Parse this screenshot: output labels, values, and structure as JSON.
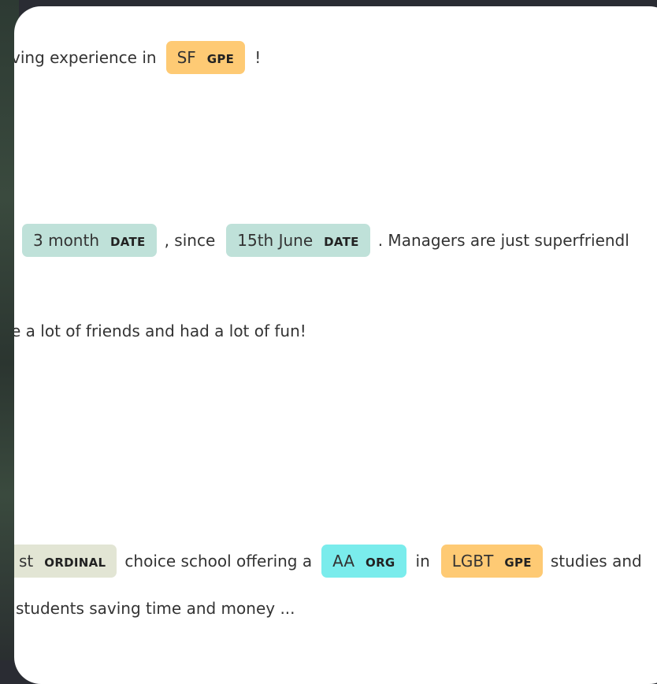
{
  "colors": {
    "GPE": "#feca74",
    "DATE": "#bfe1d9",
    "ORDINAL": "#e2e5d4",
    "ORG": "#7aecec"
  },
  "line1": {
    "text_before": "ving experience in",
    "ent1": {
      "text": "SF",
      "label": "GPE"
    },
    "text_after": "!"
  },
  "line2": {
    "ent1": {
      "text": "3 month",
      "label": "DATE"
    },
    "text_mid": ", since",
    "ent2": {
      "text": "15th June",
      "label": "DATE"
    },
    "text_after": ". Managers are just superfriendl"
  },
  "line3": {
    "text": "e a lot of friends and had a lot of fun!"
  },
  "line4": {
    "ent1": {
      "text": "st",
      "label": "ORDINAL"
    },
    "text_mid1": "choice school offering a",
    "ent2": {
      "text": "AA",
      "label": "ORG"
    },
    "text_mid2": "in",
    "ent3": {
      "text": "LGBT",
      "label": "GPE"
    },
    "text_after": "studies and"
  },
  "line5": {
    "text": "students saving time and money ..."
  }
}
